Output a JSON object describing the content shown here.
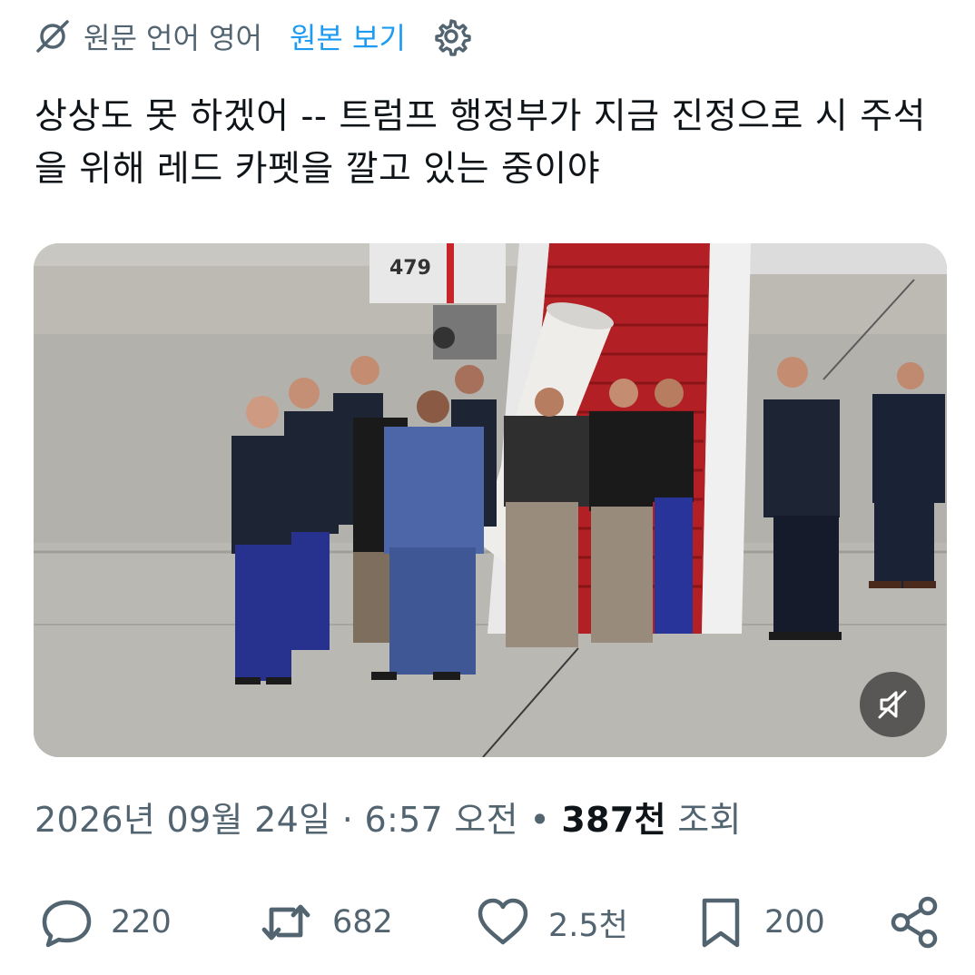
{
  "translation_bar": {
    "translated_icon": "translate-off-icon",
    "source_language": "원문 언어 영어",
    "view_original_label": "원본 보기",
    "settings_icon": "gear-icon"
  },
  "tweet": {
    "text": "상상도 못 하겠어 -- 트럼프 행정부가 지금 진정으로 시 주석을 위해 레드 카펫을 깔고 있는 중이야"
  },
  "media": {
    "stair_number": "479",
    "mute_icon": "speaker-muted-icon"
  },
  "meta": {
    "date": "2026년 09월 24일",
    "separator1": " · ",
    "time": "6:57 오전",
    "separator2": " • ",
    "views_count": "387천",
    "views_label": " 조회"
  },
  "actions": {
    "reply": {
      "icon": "reply-icon",
      "count": "220"
    },
    "retweet": {
      "icon": "retweet-icon",
      "count": "682"
    },
    "like": {
      "icon": "heart-icon",
      "count": "2.5천"
    },
    "bookmark": {
      "icon": "bookmark-icon",
      "count": "200"
    },
    "share": {
      "icon": "share-icon"
    }
  },
  "colors": {
    "accent": "#1d9bf0",
    "secondary_text": "#536471",
    "primary_text": "#0f1419",
    "carpet_red": "#b21f24"
  }
}
